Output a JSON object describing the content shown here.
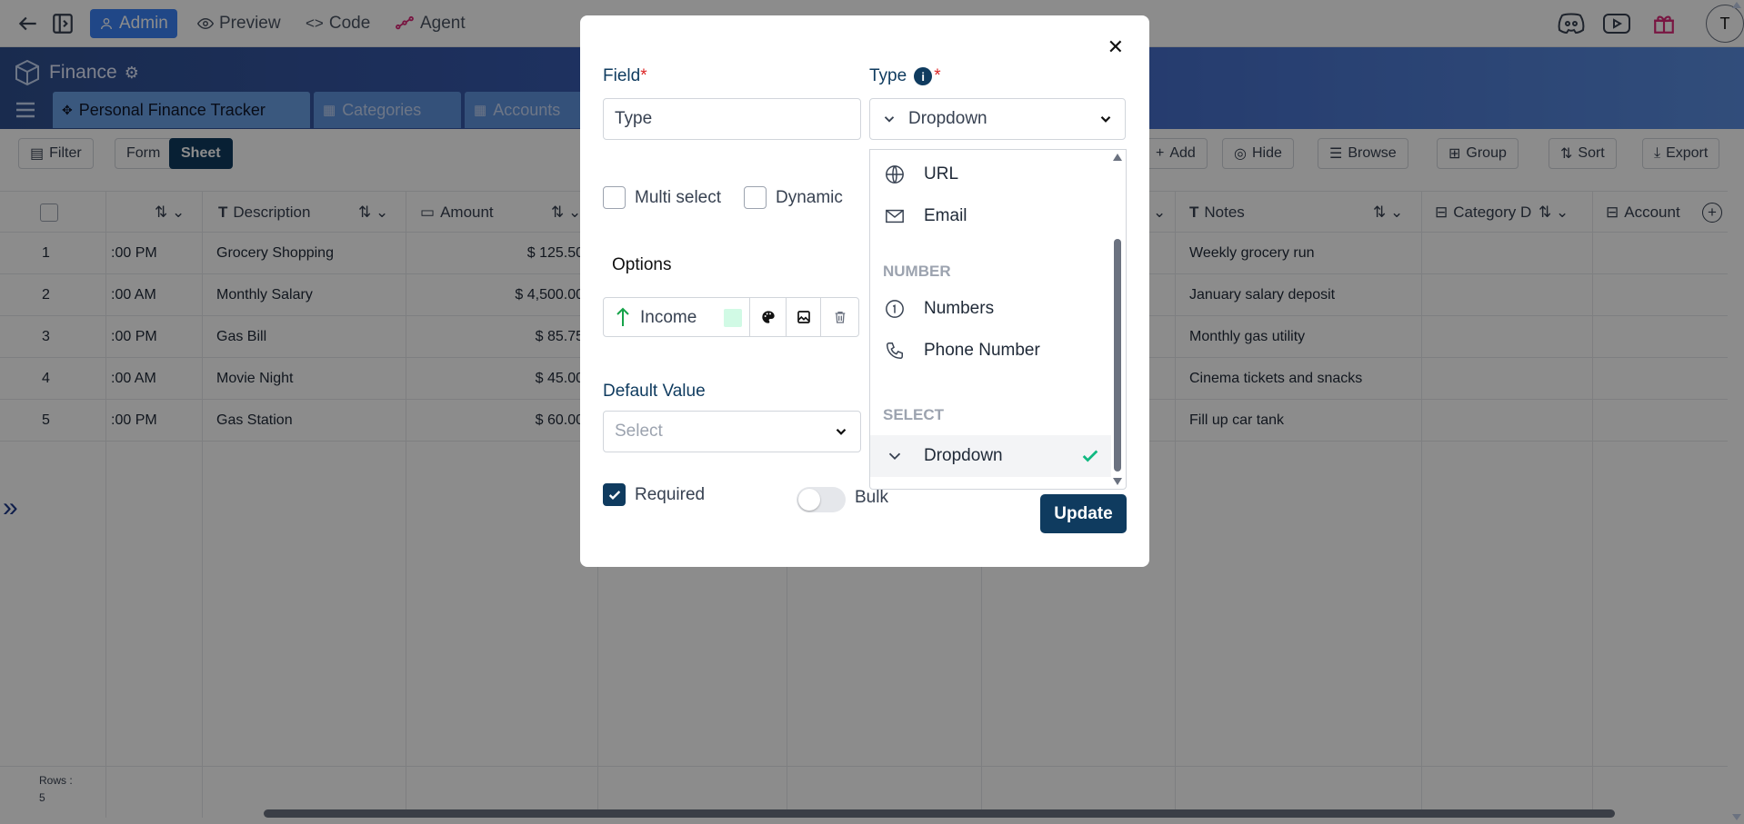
{
  "topbar": {
    "admin_label": "Admin",
    "preview_label": "Preview",
    "code_label": "Code",
    "agent_label": "Agent",
    "avatar_initial": "T"
  },
  "header": {
    "app_title": "Finance",
    "tabs": [
      {
        "label": "Personal Finance Tracker"
      },
      {
        "label": "Categories"
      },
      {
        "label": "Accounts"
      }
    ]
  },
  "toolbar": {
    "filter_label": "Filter",
    "form_label": "Form",
    "sheet_label": "Sheet",
    "add_label": "Add",
    "hide_label": "Hide",
    "browse_label": "Browse",
    "group_label": "Group",
    "sort_label": "Sort",
    "export_label": "Export"
  },
  "grid": {
    "columns": {
      "description": "Description",
      "amount": "Amount",
      "notes": "Notes",
      "category": "Category D",
      "account": "Account"
    },
    "rows": [
      {
        "num": "1",
        "time": ":00 PM",
        "description": "Grocery Shopping",
        "amount": "$ 125.50",
        "notes": "Weekly grocery run"
      },
      {
        "num": "2",
        "time": ":00 AM",
        "description": "Monthly Salary",
        "amount": "$ 4,500.00",
        "notes": "January salary deposit"
      },
      {
        "num": "3",
        "time": ":00 PM",
        "description": "Gas Bill",
        "amount": "$ 85.75",
        "notes": "Monthly gas utility"
      },
      {
        "num": "4",
        "time": ":00 AM",
        "description": "Movie Night",
        "amount": "$ 45.00",
        "notes": "Cinema tickets and snacks"
      },
      {
        "num": "5",
        "time": ":00 PM",
        "description": "Gas Station",
        "amount": "$ 60.00",
        "notes": "Fill up car tank"
      }
    ],
    "rows_label": "Rows :",
    "rows_count": "5"
  },
  "modal": {
    "field_label": "Field",
    "field_value": "Type",
    "type_label": "Type",
    "type_value": "Dropdown",
    "multi_select_label": "Multi select",
    "dynamic_label": "Dynamic",
    "options_label": "Options",
    "option_item": "Income",
    "default_value_label": "Default Value",
    "default_placeholder": "Select",
    "required_label": "Required",
    "bulk_label": "Bulk",
    "update_label": "Update",
    "required_checked": true,
    "option_color": "#d1fae5"
  },
  "type_dropdown": {
    "items_top": [
      {
        "label": "URL",
        "icon": "globe-icon"
      },
      {
        "label": "Email",
        "icon": "mail-icon"
      }
    ],
    "group_number": "NUMBER",
    "items_number": [
      {
        "label": "Numbers",
        "icon": "number-icon"
      },
      {
        "label": "Phone Number",
        "icon": "phone-icon"
      }
    ],
    "group_select": "SELECT",
    "selected_item": {
      "label": "Dropdown",
      "icon": "chevron-down-icon"
    }
  },
  "colors": {
    "brand_dark": "#0f3b5f",
    "accent_green": "#10b981",
    "required_red": "#dc2626"
  }
}
